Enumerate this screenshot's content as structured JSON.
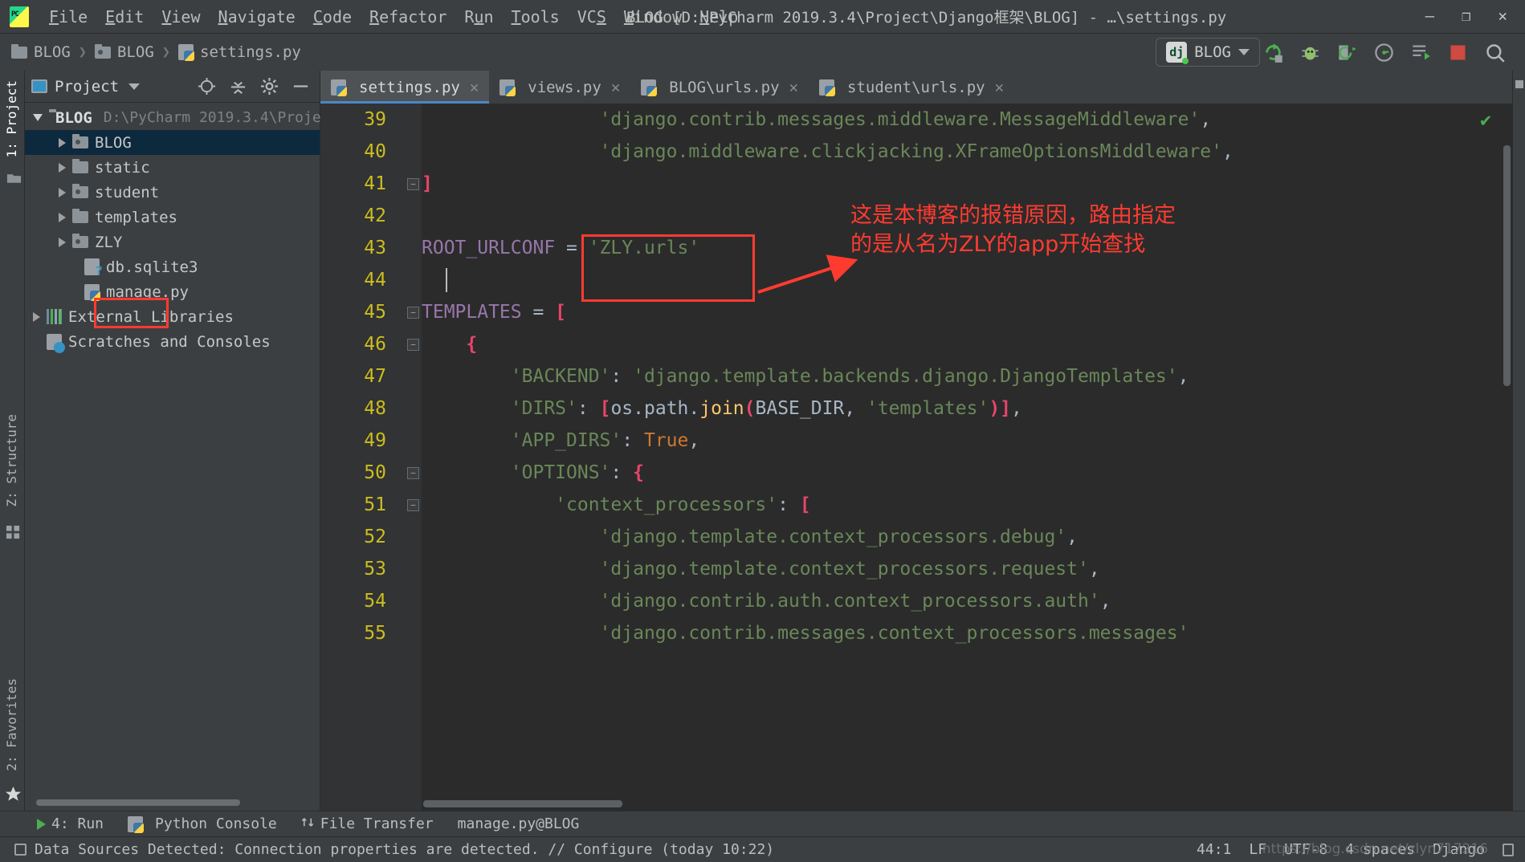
{
  "window": {
    "title": "BLOG [D:\\PyCharm 2019.3.4\\Project\\Django框架\\BLOG] - …\\settings.py",
    "minimize": "–",
    "maximize": "❐",
    "close": "✕",
    "app_icon": "pycharm-logo-icon"
  },
  "menubar": [
    {
      "label": "File",
      "mnemonic": "F"
    },
    {
      "label": "Edit",
      "mnemonic": "E"
    },
    {
      "label": "View",
      "mnemonic": "V"
    },
    {
      "label": "Navigate",
      "mnemonic": "N"
    },
    {
      "label": "Code",
      "mnemonic": "C"
    },
    {
      "label": "Refactor",
      "mnemonic": "R"
    },
    {
      "label": "Run",
      "mnemonic": "n"
    },
    {
      "label": "Tools",
      "mnemonic": "T"
    },
    {
      "label": "VCS",
      "mnemonic": "S"
    },
    {
      "label": "Window",
      "mnemonic": "W"
    },
    {
      "label": "Help",
      "mnemonic": "H"
    }
  ],
  "breadcrumb": [
    {
      "label": "BLOG",
      "icon": "folder-icon"
    },
    {
      "label": "BLOG",
      "icon": "source-folder-icon"
    },
    {
      "label": "settings.py",
      "icon": "python-file-icon"
    }
  ],
  "run_config": {
    "name": "BLOG",
    "icon": "django-icon",
    "dropdown": "chevron-down-icon"
  },
  "toolbar_buttons": [
    {
      "name": "rerun-icon"
    },
    {
      "name": "debug-icon"
    },
    {
      "name": "coverage-icon"
    },
    {
      "name": "profile-icon"
    },
    {
      "name": "run-with-console-icon"
    },
    {
      "name": "stop-icon"
    },
    {
      "name": "search-everywhere-icon"
    }
  ],
  "left_rail": {
    "top": [
      "1: Project",
      "favorites-star"
    ],
    "middle": "Z: Structure",
    "bottom": "2: Favorites"
  },
  "project_panel": {
    "title": "Project",
    "tools": [
      "locate-icon",
      "collapse-all-icon",
      "settings-gear-icon",
      "hide-icon"
    ],
    "tree": [
      {
        "label": "BLOG",
        "path": "D:\\PyCharm 2019.3.4\\Proje",
        "state": "open",
        "icon": "folder-icon",
        "depth": 0,
        "bold": true,
        "selected": false
      },
      {
        "label": "BLOG",
        "path": "",
        "state": "closed",
        "icon": "source-folder-icon",
        "depth": 1,
        "bold": false,
        "selected": true
      },
      {
        "label": "static",
        "path": "",
        "state": "closed",
        "icon": "folder-icon",
        "depth": 1,
        "bold": false,
        "selected": false
      },
      {
        "label": "student",
        "path": "",
        "state": "closed",
        "icon": "source-folder-icon",
        "depth": 1,
        "bold": false,
        "selected": false
      },
      {
        "label": "templates",
        "path": "",
        "state": "closed",
        "icon": "folder-icon",
        "depth": 1,
        "bold": false,
        "selected": false
      },
      {
        "label": "ZLY",
        "path": "",
        "state": "closed",
        "icon": "source-folder-icon",
        "depth": 1,
        "bold": false,
        "selected": false
      },
      {
        "label": "db.sqlite3",
        "path": "",
        "state": "leaf",
        "icon": "db-file-icon",
        "depth": 2,
        "bold": false,
        "selected": false
      },
      {
        "label": "manage.py",
        "path": "",
        "state": "leaf",
        "icon": "python-file-icon",
        "depth": 2,
        "bold": false,
        "selected": false
      },
      {
        "label": "External Libraries",
        "path": "",
        "state": "closed",
        "icon": "library-icon",
        "depth": 0,
        "bold": false,
        "selected": false
      },
      {
        "label": "Scratches and Consoles",
        "path": "",
        "state": "leaf",
        "icon": "scratches-icon",
        "depth": 0,
        "bold": false,
        "selected": false
      }
    ]
  },
  "editor": {
    "tabs": [
      {
        "label": "settings.py",
        "active": true,
        "icon": "python-file-icon",
        "close": "✕"
      },
      {
        "label": "views.py",
        "active": false,
        "icon": "python-file-icon",
        "close": "✕"
      },
      {
        "label": "BLOG\\urls.py",
        "active": false,
        "icon": "python-file-icon",
        "close": "✕"
      },
      {
        "label": "student\\urls.py",
        "active": false,
        "icon": "python-file-icon",
        "close": "✕"
      }
    ],
    "lines": [
      {
        "n": "39",
        "indent": 4,
        "tokens": [
          {
            "t": "'django.contrib.messages.middleware.MessageMiddleware'",
            "c": "s-str"
          },
          {
            "t": ",",
            "c": "s-def"
          }
        ]
      },
      {
        "n": "40",
        "indent": 4,
        "tokens": [
          {
            "t": "'django.middleware.clickjacking.XFrameOptionsMiddleware'",
            "c": "s-str"
          },
          {
            "t": ",",
            "c": "s-def"
          }
        ]
      },
      {
        "n": "41",
        "indent": 0,
        "fold": "minus",
        "tokens": [
          {
            "t": "]",
            "c": "s-brk"
          }
        ]
      },
      {
        "n": "42",
        "indent": 0,
        "tokens": []
      },
      {
        "n": "43",
        "indent": 0,
        "tokens": [
          {
            "t": "ROOT_URLCONF",
            "c": "s-cap"
          },
          {
            "t": " = ",
            "c": "s-def"
          },
          {
            "t": "'ZLY.urls'",
            "c": "s-str"
          }
        ]
      },
      {
        "n": "44",
        "indent": 0,
        "caret": true,
        "tokens": []
      },
      {
        "n": "45",
        "indent": 0,
        "fold": "minus",
        "tokens": [
          {
            "t": "TEMPLATES",
            "c": "s-cap"
          },
          {
            "t": " = ",
            "c": "s-def"
          },
          {
            "t": "[",
            "c": "s-brk"
          }
        ]
      },
      {
        "n": "46",
        "indent": 1,
        "fold": "minus",
        "tokens": [
          {
            "t": "{",
            "c": "s-brk"
          }
        ]
      },
      {
        "n": "47",
        "indent": 2,
        "tokens": [
          {
            "t": "'BACKEND'",
            "c": "s-str"
          },
          {
            "t": ": ",
            "c": "s-def"
          },
          {
            "t": "'django.template.backends.django.DjangoTemplates'",
            "c": "s-str"
          },
          {
            "t": ",",
            "c": "s-def"
          }
        ]
      },
      {
        "n": "48",
        "indent": 2,
        "tokens": [
          {
            "t": "'DIRS'",
            "c": "s-str"
          },
          {
            "t": ": ",
            "c": "s-def"
          },
          {
            "t": "[",
            "c": "s-brk"
          },
          {
            "t": "os",
            "c": "s-id"
          },
          {
            "t": ".",
            "c": "s-def"
          },
          {
            "t": "path",
            "c": "s-id"
          },
          {
            "t": ".",
            "c": "s-def"
          },
          {
            "t": "join",
            "c": "s-fn"
          },
          {
            "t": "(",
            "c": "s-brk"
          },
          {
            "t": "BASE_DIR",
            "c": "s-id"
          },
          {
            "t": ", ",
            "c": "s-def"
          },
          {
            "t": "'templates'",
            "c": "s-str"
          },
          {
            "t": ")]",
            "c": "s-brk"
          },
          {
            "t": ",",
            "c": "s-def"
          }
        ]
      },
      {
        "n": "49",
        "indent": 2,
        "tokens": [
          {
            "t": "'APP_DIRS'",
            "c": "s-str"
          },
          {
            "t": ": ",
            "c": "s-def"
          },
          {
            "t": "True",
            "c": "s-true"
          },
          {
            "t": ",",
            "c": "s-def"
          }
        ]
      },
      {
        "n": "50",
        "indent": 2,
        "fold": "minus",
        "tokens": [
          {
            "t": "'OPTIONS'",
            "c": "s-str"
          },
          {
            "t": ": ",
            "c": "s-def"
          },
          {
            "t": "{",
            "c": "s-brk"
          }
        ]
      },
      {
        "n": "51",
        "indent": 3,
        "fold": "minus",
        "tokens": [
          {
            "t": "'context_processors'",
            "c": "s-str"
          },
          {
            "t": ": ",
            "c": "s-def"
          },
          {
            "t": "[",
            "c": "s-brk"
          }
        ]
      },
      {
        "n": "52",
        "indent": 4,
        "tokens": [
          {
            "t": "'django.template.context_processors.debug'",
            "c": "s-str"
          },
          {
            "t": ",",
            "c": "s-def"
          }
        ]
      },
      {
        "n": "53",
        "indent": 4,
        "tokens": [
          {
            "t": "'django.template.context_processors.request'",
            "c": "s-str"
          },
          {
            "t": ",",
            "c": "s-def"
          }
        ]
      },
      {
        "n": "54",
        "indent": 4,
        "tokens": [
          {
            "t": "'django.contrib.auth.context_processors.auth'",
            "c": "s-str"
          },
          {
            "t": ",",
            "c": "s-def"
          }
        ]
      },
      {
        "n": "55",
        "indent": 4,
        "tokens": [
          {
            "t": "'django.contrib.messages.context_processors.messages'",
            "c": "s-str"
          }
        ]
      }
    ],
    "inspection_status": "✔"
  },
  "annotation": {
    "color": "#ff3b30",
    "text_line1": "这是本博客的报错原因，路由指定",
    "text_line2": "的是从名为ZLY的app开始查找",
    "boxes": [
      "zly-folder-highlight",
      "root-urlconf-highlight"
    ],
    "arrow": "red-arrow"
  },
  "bottom_toolbar": [
    {
      "label": "4: Run",
      "icon": "run-icon",
      "mnemonic": "4"
    },
    {
      "label": "Python Console",
      "icon": "python-console-icon",
      "mnemonic": ""
    },
    {
      "label": "File Transfer",
      "icon": "file-transfer-icon",
      "mnemonic": ""
    },
    {
      "label": "manage.py@BLOG",
      "icon": "",
      "mnemonic": ""
    }
  ],
  "statusbar": {
    "message": "Data Sources Detected: Connection properties are detected. // Configure (today 10:22)",
    "caret_position": "44:1",
    "line_separator": "LF",
    "encoding": "UTF-8",
    "indent": "4 spaces",
    "framework": "Django",
    "lock": "lock-icon",
    "watermark": "https://blog.csdn.net/zlyn717216"
  }
}
